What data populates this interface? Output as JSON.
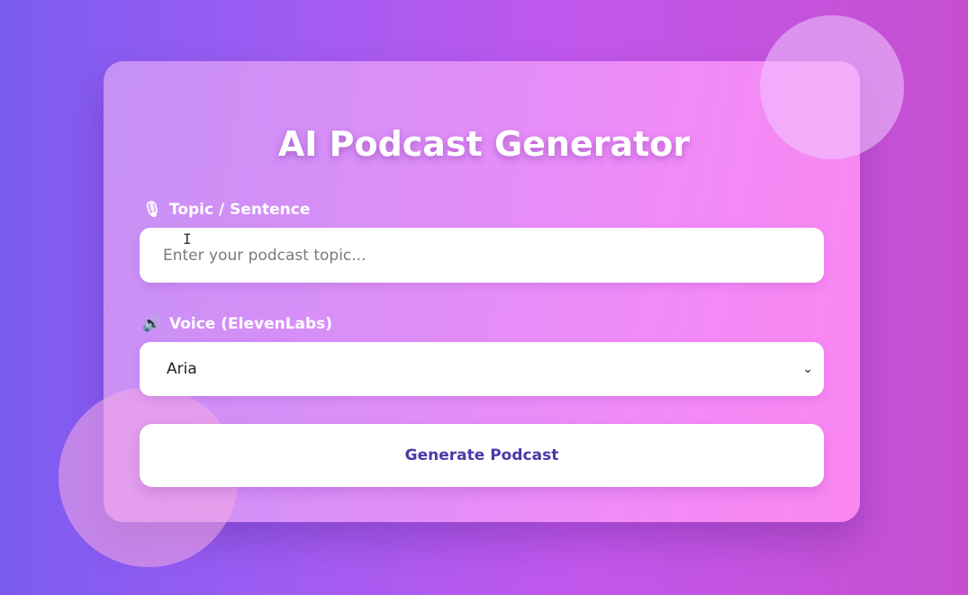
{
  "app": {
    "title": "AI Podcast Generator"
  },
  "form": {
    "topic": {
      "icon": "microphone-icon",
      "icon_glyph": "🎙",
      "label": "Topic / Sentence",
      "value": "",
      "placeholder": "Enter your podcast topic..."
    },
    "voice": {
      "icon": "speaker-icon",
      "icon_glyph": "🔊",
      "label": "Voice (ElevenLabs)",
      "selected": "Aria"
    },
    "generate_label": "Generate Podcast"
  },
  "colors": {
    "background_start": "#7b5cf0",
    "background_end": "#c64fcf",
    "card_start": "#c590f5",
    "card_end": "#fb86f0",
    "button_text": "#4a3aa8"
  }
}
